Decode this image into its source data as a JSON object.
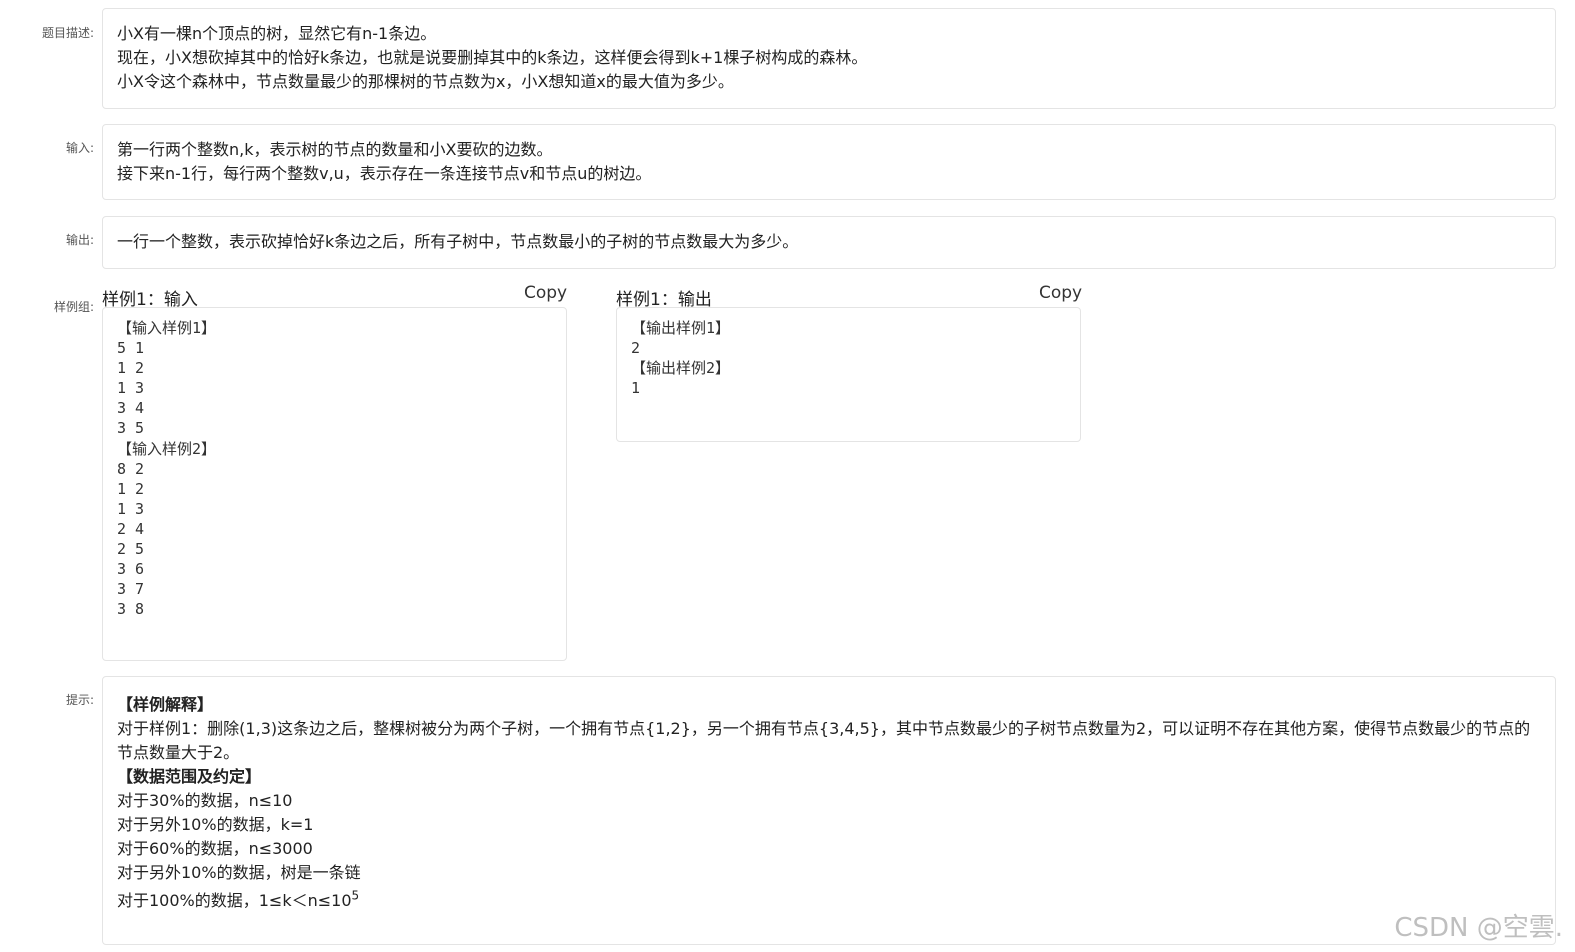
{
  "description": {
    "label": "题目描述:",
    "lines": [
      "小X有一棵n个顶点的树，显然它有n-1条边。",
      "现在，小X想砍掉其中的恰好k条边，也就是说要删掉其中的k条边，这样便会得到k+1棵子树构成的森林。",
      "小X令这个森林中，节点数量最少的那棵树的节点数为x，小X想知道x的最大值为多少。"
    ]
  },
  "input": {
    "label": "输入:",
    "lines": [
      "第一行两个整数n,k，表示树的节点的数量和小X要砍的边数。",
      "接下来n-1行，每行两个整数v,u，表示存在一条连接节点v和节点u的树边。"
    ]
  },
  "output": {
    "label": "输出:",
    "lines": [
      "一行一个整数，表示砍掉恰好k条边之后，所有子树中，节点数最小的子树的节点数最大为多少。"
    ]
  },
  "samples": {
    "label": "样例组:",
    "input_title": "样例1：输入",
    "output_title": "样例1：输出",
    "copy_label": "Copy",
    "input_text": "【输入样例1】\n5 1\n1 2\n1 3\n3 4\n3 5\n【输入样例2】\n8 2\n1 2\n1 3\n2 4\n2 5\n3 6\n3 7\n3 8",
    "output_text": "【输出样例1】\n2\n【输出样例2】\n1"
  },
  "hint": {
    "label": "提示:",
    "explain_title": "【样例解释】",
    "explain_text": "对于样例1：删除(1,3)这条边之后，整棵树被分为两个子树，一个拥有节点{1,2}，另一个拥有节点{3,4,5}，其中节点数最少的子树节点数量为2，可以证明不存在其他方案，使得节点数最少的节点的节点数量大于2。",
    "range_title": "【数据范围及约定】",
    "range_lines": [
      "对于30%的数据，n≤10",
      "对于另外10%的数据，k=1",
      "对于60%的数据，n≤3000",
      "对于另外10%的数据，树是一条链"
    ],
    "last_line_prefix": "对于100%的数据，1≤k＜n≤10",
    "last_line_sup": "5"
  },
  "watermark": "CSDN @空雲."
}
